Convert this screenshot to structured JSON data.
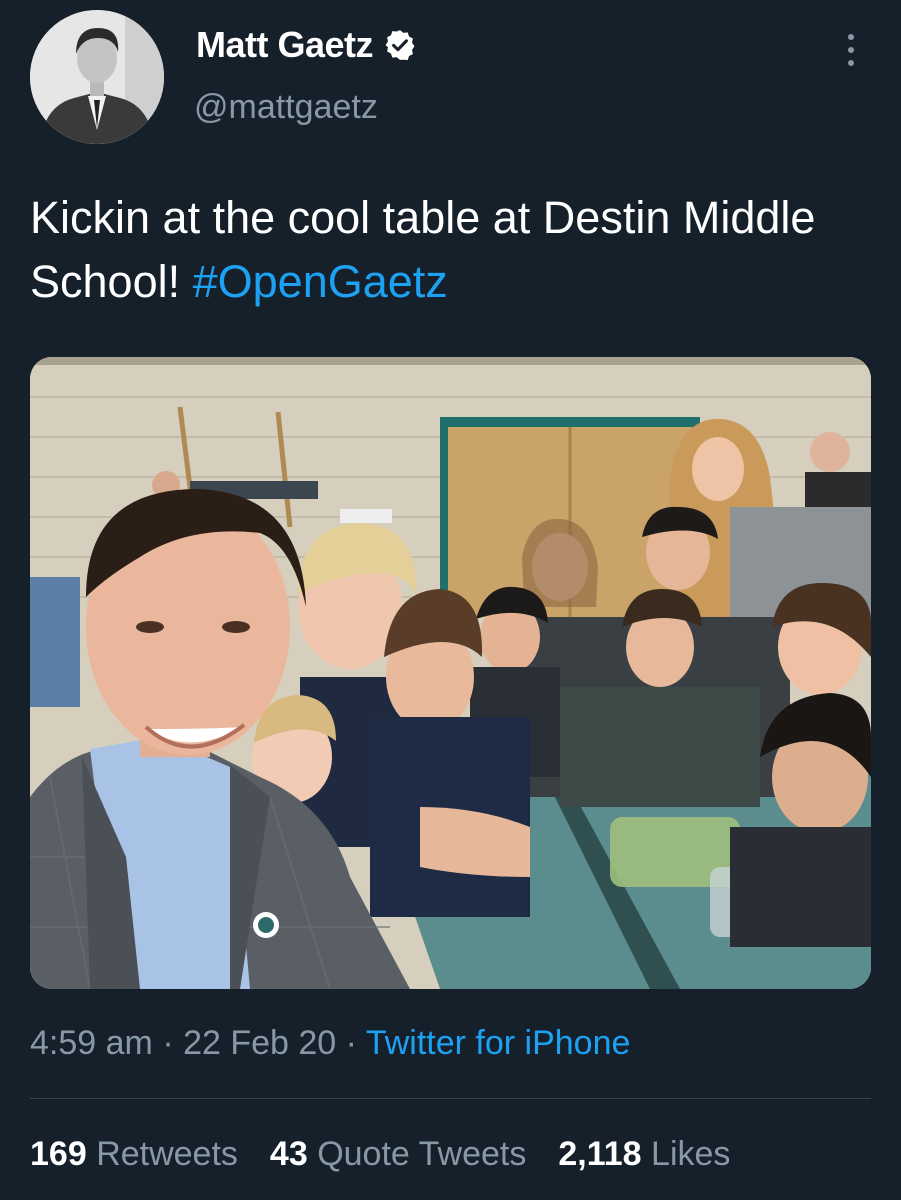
{
  "user": {
    "display_name": "Matt Gaetz",
    "handle": "@mattgaetz",
    "verified": true
  },
  "tweet": {
    "text": "Kickin at the cool table at Destin Middle School!",
    "hashtag": "#OpenGaetz"
  },
  "meta": {
    "time": "4:59 am",
    "date": "22 Feb 20",
    "separator": "·",
    "source": "Twitter for iPhone"
  },
  "stats": [
    {
      "count": "169",
      "label": "Retweets"
    },
    {
      "count": "43",
      "label": "Quote Tweets"
    },
    {
      "count": "2,118",
      "label": "Likes"
    }
  ],
  "colors": {
    "background": "#15202b",
    "accent": "#1da1f2",
    "secondary_text": "#8899a6",
    "divider": "#38444d"
  },
  "icons": {
    "verified": "verified-badge-icon",
    "more": "more-vertical-icon"
  }
}
